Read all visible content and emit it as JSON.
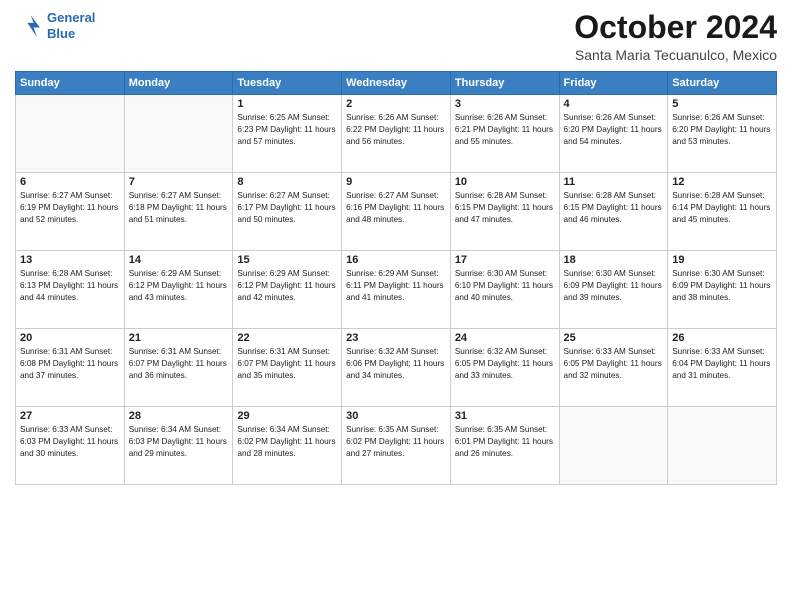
{
  "header": {
    "logo_line1": "General",
    "logo_line2": "Blue",
    "month_title": "October 2024",
    "location": "Santa Maria Tecuanulco, Mexico"
  },
  "weekdays": [
    "Sunday",
    "Monday",
    "Tuesday",
    "Wednesday",
    "Thursday",
    "Friday",
    "Saturday"
  ],
  "weeks": [
    [
      {
        "day": "",
        "info": ""
      },
      {
        "day": "",
        "info": ""
      },
      {
        "day": "1",
        "info": "Sunrise: 6:25 AM\nSunset: 6:23 PM\nDaylight: 11 hours and 57 minutes."
      },
      {
        "day": "2",
        "info": "Sunrise: 6:26 AM\nSunset: 6:22 PM\nDaylight: 11 hours and 56 minutes."
      },
      {
        "day": "3",
        "info": "Sunrise: 6:26 AM\nSunset: 6:21 PM\nDaylight: 11 hours and 55 minutes."
      },
      {
        "day": "4",
        "info": "Sunrise: 6:26 AM\nSunset: 6:20 PM\nDaylight: 11 hours and 54 minutes."
      },
      {
        "day": "5",
        "info": "Sunrise: 6:26 AM\nSunset: 6:20 PM\nDaylight: 11 hours and 53 minutes."
      }
    ],
    [
      {
        "day": "6",
        "info": "Sunrise: 6:27 AM\nSunset: 6:19 PM\nDaylight: 11 hours and 52 minutes."
      },
      {
        "day": "7",
        "info": "Sunrise: 6:27 AM\nSunset: 6:18 PM\nDaylight: 11 hours and 51 minutes."
      },
      {
        "day": "8",
        "info": "Sunrise: 6:27 AM\nSunset: 6:17 PM\nDaylight: 11 hours and 50 minutes."
      },
      {
        "day": "9",
        "info": "Sunrise: 6:27 AM\nSunset: 6:16 PM\nDaylight: 11 hours and 48 minutes."
      },
      {
        "day": "10",
        "info": "Sunrise: 6:28 AM\nSunset: 6:15 PM\nDaylight: 11 hours and 47 minutes."
      },
      {
        "day": "11",
        "info": "Sunrise: 6:28 AM\nSunset: 6:15 PM\nDaylight: 11 hours and 46 minutes."
      },
      {
        "day": "12",
        "info": "Sunrise: 6:28 AM\nSunset: 6:14 PM\nDaylight: 11 hours and 45 minutes."
      }
    ],
    [
      {
        "day": "13",
        "info": "Sunrise: 6:28 AM\nSunset: 6:13 PM\nDaylight: 11 hours and 44 minutes."
      },
      {
        "day": "14",
        "info": "Sunrise: 6:29 AM\nSunset: 6:12 PM\nDaylight: 11 hours and 43 minutes."
      },
      {
        "day": "15",
        "info": "Sunrise: 6:29 AM\nSunset: 6:12 PM\nDaylight: 11 hours and 42 minutes."
      },
      {
        "day": "16",
        "info": "Sunrise: 6:29 AM\nSunset: 6:11 PM\nDaylight: 11 hours and 41 minutes."
      },
      {
        "day": "17",
        "info": "Sunrise: 6:30 AM\nSunset: 6:10 PM\nDaylight: 11 hours and 40 minutes."
      },
      {
        "day": "18",
        "info": "Sunrise: 6:30 AM\nSunset: 6:09 PM\nDaylight: 11 hours and 39 minutes."
      },
      {
        "day": "19",
        "info": "Sunrise: 6:30 AM\nSunset: 6:09 PM\nDaylight: 11 hours and 38 minutes."
      }
    ],
    [
      {
        "day": "20",
        "info": "Sunrise: 6:31 AM\nSunset: 6:08 PM\nDaylight: 11 hours and 37 minutes."
      },
      {
        "day": "21",
        "info": "Sunrise: 6:31 AM\nSunset: 6:07 PM\nDaylight: 11 hours and 36 minutes."
      },
      {
        "day": "22",
        "info": "Sunrise: 6:31 AM\nSunset: 6:07 PM\nDaylight: 11 hours and 35 minutes."
      },
      {
        "day": "23",
        "info": "Sunrise: 6:32 AM\nSunset: 6:06 PM\nDaylight: 11 hours and 34 minutes."
      },
      {
        "day": "24",
        "info": "Sunrise: 6:32 AM\nSunset: 6:05 PM\nDaylight: 11 hours and 33 minutes."
      },
      {
        "day": "25",
        "info": "Sunrise: 6:33 AM\nSunset: 6:05 PM\nDaylight: 11 hours and 32 minutes."
      },
      {
        "day": "26",
        "info": "Sunrise: 6:33 AM\nSunset: 6:04 PM\nDaylight: 11 hours and 31 minutes."
      }
    ],
    [
      {
        "day": "27",
        "info": "Sunrise: 6:33 AM\nSunset: 6:03 PM\nDaylight: 11 hours and 30 minutes."
      },
      {
        "day": "28",
        "info": "Sunrise: 6:34 AM\nSunset: 6:03 PM\nDaylight: 11 hours and 29 minutes."
      },
      {
        "day": "29",
        "info": "Sunrise: 6:34 AM\nSunset: 6:02 PM\nDaylight: 11 hours and 28 minutes."
      },
      {
        "day": "30",
        "info": "Sunrise: 6:35 AM\nSunset: 6:02 PM\nDaylight: 11 hours and 27 minutes."
      },
      {
        "day": "31",
        "info": "Sunrise: 6:35 AM\nSunset: 6:01 PM\nDaylight: 11 hours and 26 minutes."
      },
      {
        "day": "",
        "info": ""
      },
      {
        "day": "",
        "info": ""
      }
    ]
  ]
}
